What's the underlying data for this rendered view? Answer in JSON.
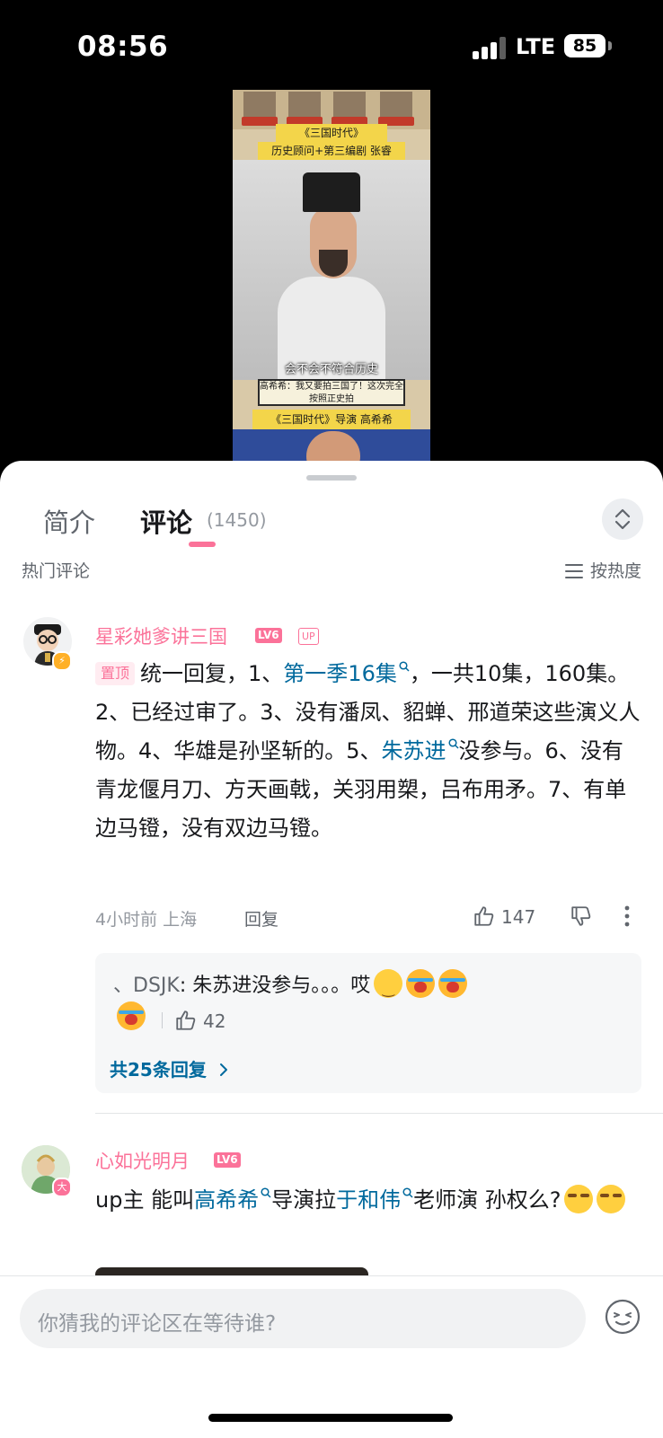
{
  "status_bar": {
    "time": "08:56",
    "network": "LTE",
    "battery": "85"
  },
  "video": {
    "caption_title": "《三国时代》",
    "caption_role": "历史顾问+第三编剧 张睿",
    "subtitle": "会不会不符合历史",
    "quote_box": "高希希：我又要拍三国了！这次完全按照正史拍",
    "caption_director": "《三国时代》导演 高希希"
  },
  "tabs": {
    "intro": "简介",
    "comments": "评论",
    "comment_count": "(1450)"
  },
  "section": {
    "title": "热门评论",
    "sort": "按热度"
  },
  "comments": [
    {
      "user": "星彩她爹讲三国",
      "level": "LV6",
      "up_tag": "UP",
      "pinned": "置顶",
      "t1": "统一回复，1、",
      "link1": "第一季16集",
      "t2": "，一共10集，160集。2、已经过审了。3、没有潘凤、貂蝉、邢道荣这些演义人物。4、华雄是孙坚斩的。5、",
      "link2": "朱苏进",
      "t3": "没参与。6、没有青龙偃月刀、方天画戟，关羽用槊，吕布用矛。7、有单边马镫，没有双边马镫。",
      "time": "4小时前 上海",
      "reply_label": "回复",
      "likes": "147",
      "reply": {
        "user": "DSJK",
        "text": ": 朱苏进没参与。。。哎",
        "likes": "42",
        "more": "共25条回复"
      }
    },
    {
      "user": "心如光明月",
      "level": "LV6",
      "badge": "大",
      "t1": "up主 能叫",
      "link1": "高希希",
      "t2": "导演拉",
      "link2": "于和伟",
      "t3": "老师演 孙权么?"
    }
  ],
  "input": {
    "placeholder": "你猜我的评论区在等待谁?"
  },
  "colors": {
    "accent": "#fb7299",
    "link": "#00699d"
  }
}
